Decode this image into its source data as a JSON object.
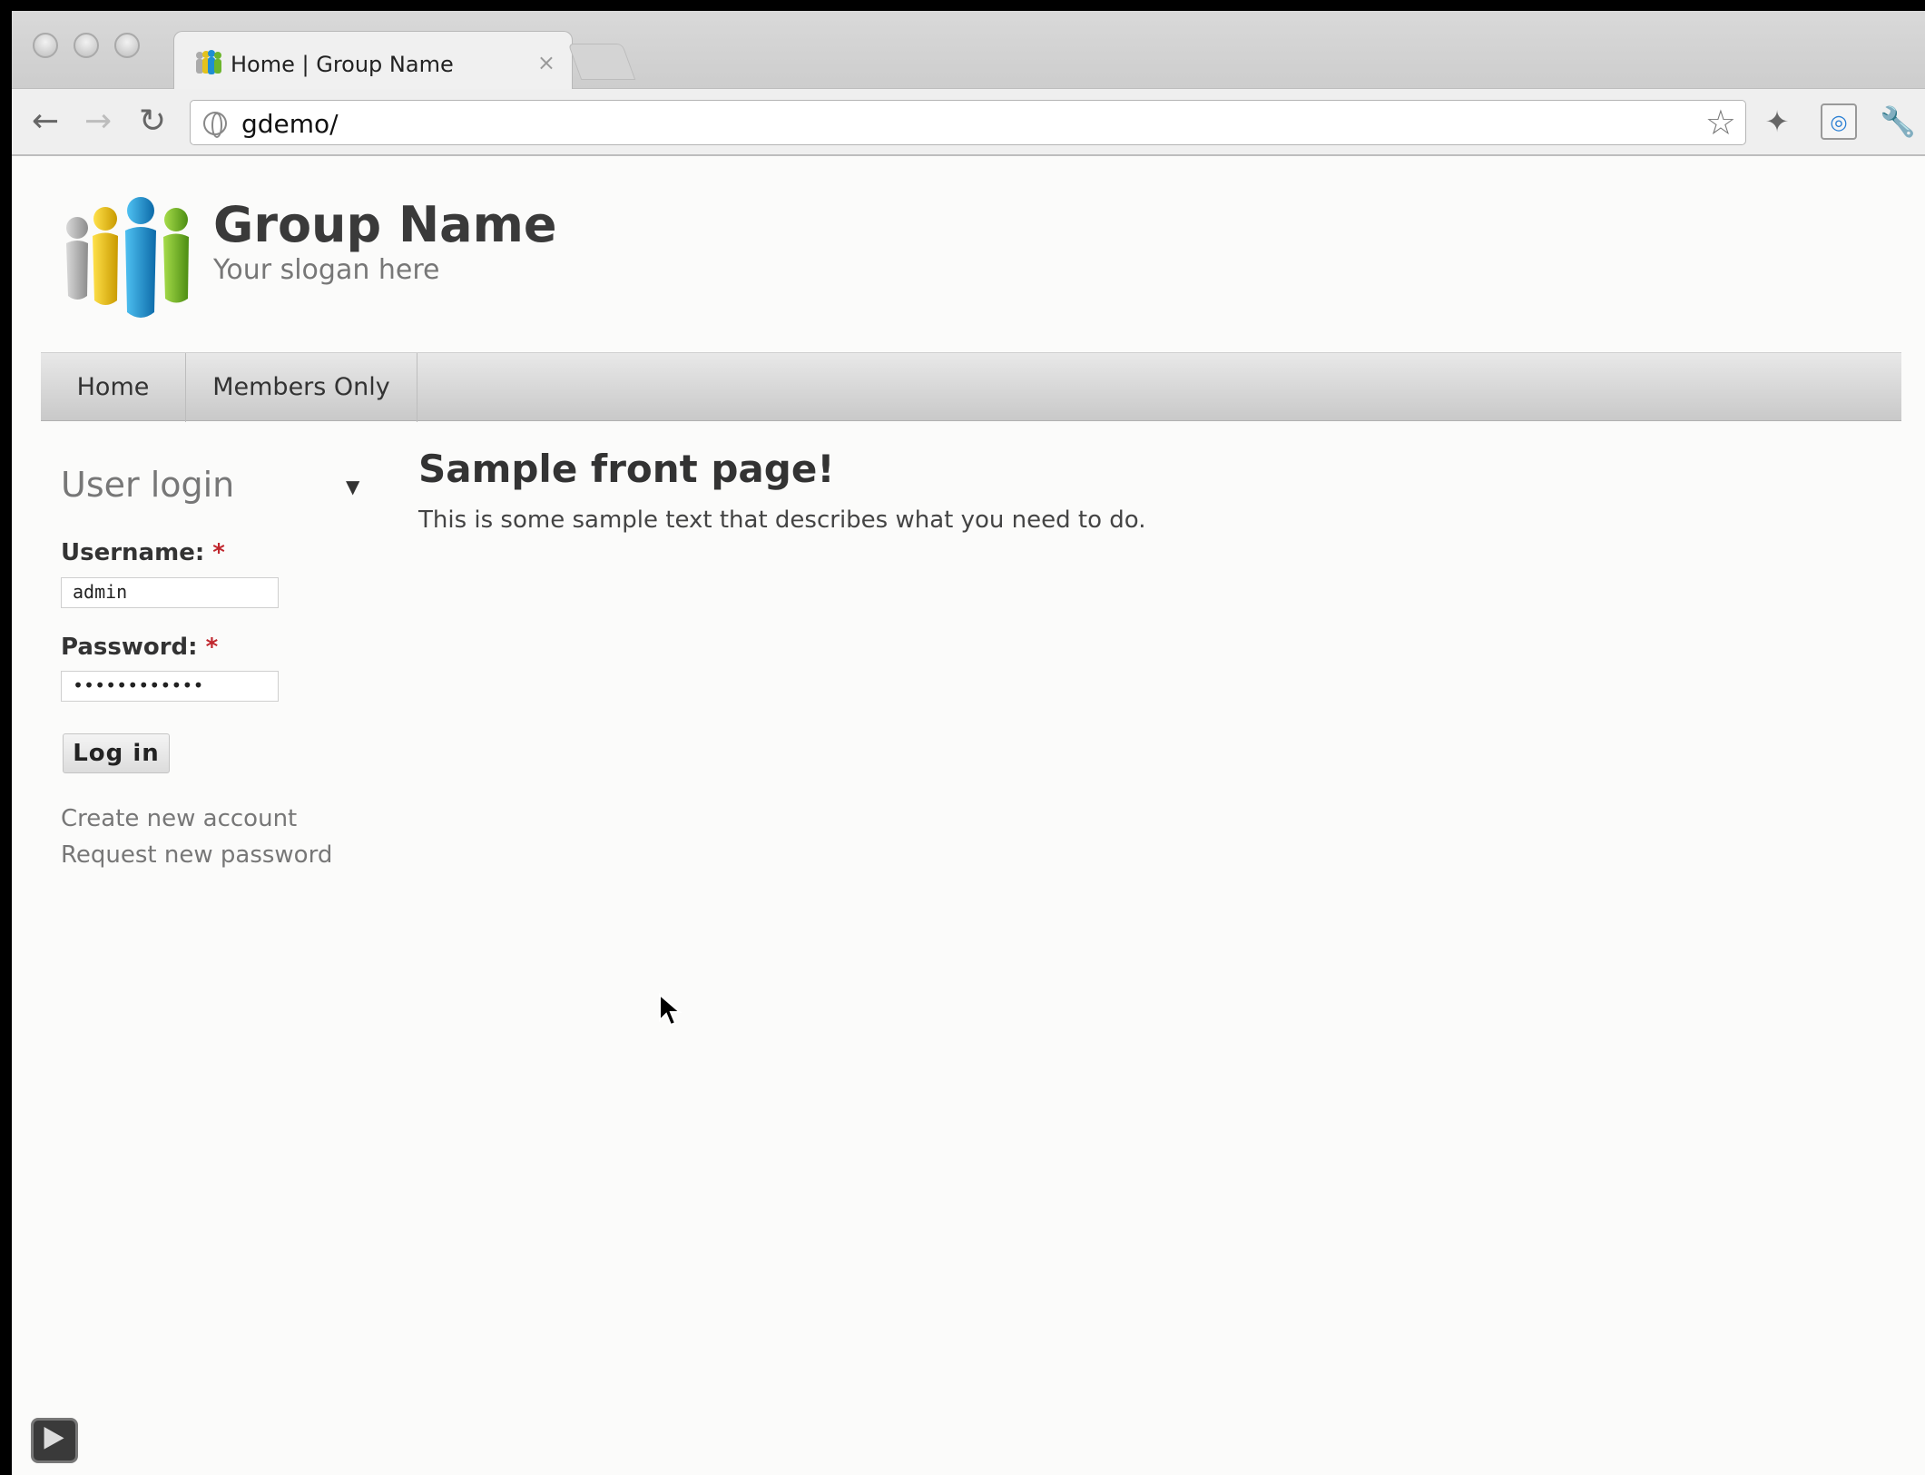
{
  "browser": {
    "tab_title": "Home | Group Name",
    "tab_close": "×",
    "url": "gdemo/"
  },
  "site": {
    "name": "Group Name",
    "slogan": "Your slogan here"
  },
  "nav": {
    "items": [
      {
        "label": "Home"
      },
      {
        "label": "Members Only"
      }
    ]
  },
  "login": {
    "title": "User login",
    "username_label": "Username:",
    "username_value": "admin",
    "password_label": "Password:",
    "password_value": "••••••••••••",
    "required_marker": "*",
    "button_label": "Log in",
    "links": [
      "Create new account",
      "Request new password"
    ]
  },
  "content": {
    "title": "Sample front page!",
    "body": "This is some sample text that describes what you need to do."
  },
  "icons": {
    "back": "back-arrow-icon",
    "forward": "forward-arrow-icon",
    "reload": "reload-icon",
    "star": "star-icon",
    "wrench": "wrench-icon",
    "play": "play-icon"
  },
  "colors": {
    "required": "#c0262d",
    "nav_bar": "#d6d6d6",
    "page_bg": "#fbfbfa"
  }
}
